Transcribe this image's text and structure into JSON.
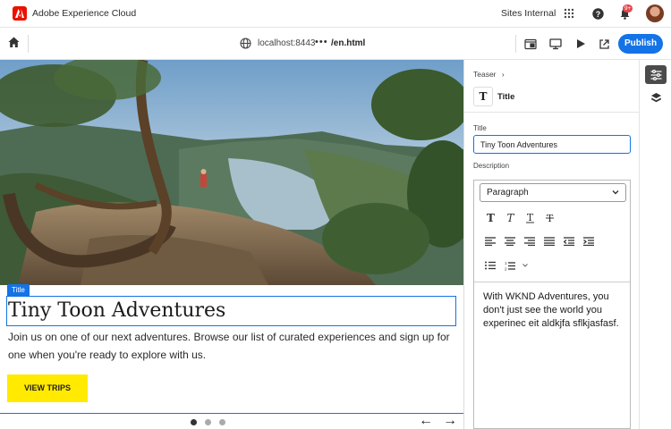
{
  "topbar": {
    "app_title": "Adobe Experience Cloud",
    "org_name": "Sites Internal",
    "notification_badge": "9+",
    "icons": [
      "adobe-logo",
      "apps-grid-icon",
      "help-icon",
      "bell-icon",
      "avatar"
    ]
  },
  "editor": {
    "host": "localhost:8443",
    "more": "•••",
    "path": "/en.html",
    "publish_label": "Publish",
    "icons": [
      "home-icon",
      "globe-icon",
      "preview-window-icon",
      "desktop-icon",
      "play-icon",
      "open-external-icon"
    ]
  },
  "canvas": {
    "title_tag": "Title",
    "teaser_title": "Tiny Toon Adventures",
    "description": "Join us on one of our next adventures. Browse our list of curated experiences and sign up for one when you're ready to explore with us.",
    "cta_label": "VIEW TRIPS",
    "carousel_count": 3,
    "carousel_active": 1,
    "prev_arrow": "←",
    "next_arrow": "→"
  },
  "panel": {
    "breadcrumb": "Teaser",
    "component_name": "Title",
    "title_label": "Title",
    "title_value": "Tiny Toon Adventures",
    "description_label": "Description",
    "paragraph_format": "Paragraph",
    "rte_text": "With WKND Adventures, you don't just see the world you experinec eit aldkjfa sflkjasfasf."
  },
  "colors": {
    "accent": "#1473e6",
    "adobe_red": "#eb1000",
    "cta_yellow": "#ffea00",
    "badge_red": "#e34850"
  }
}
